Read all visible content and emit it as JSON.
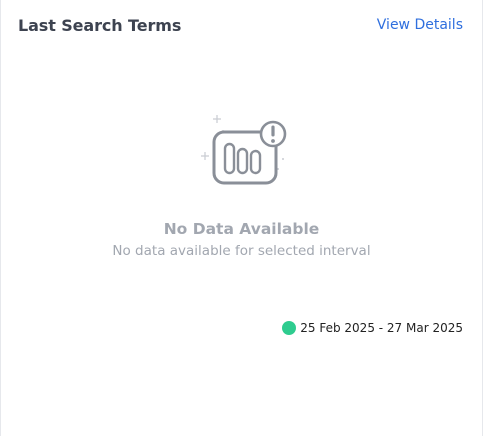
{
  "card": {
    "title": "Last Search Terms",
    "action_label": "View Details"
  },
  "empty_state": {
    "icon": "chart-warning-icon",
    "title": "No Data Available",
    "subtitle": "No data available for selected interval"
  },
  "legend": {
    "date_range": "25 Feb 2025 - 27 Mar 2025",
    "color": "#2ecc8f"
  },
  "colors": {
    "accent": "#2f6fde",
    "icon_stroke": "#8a8f98",
    "muted_text": "#a2a7b0"
  }
}
